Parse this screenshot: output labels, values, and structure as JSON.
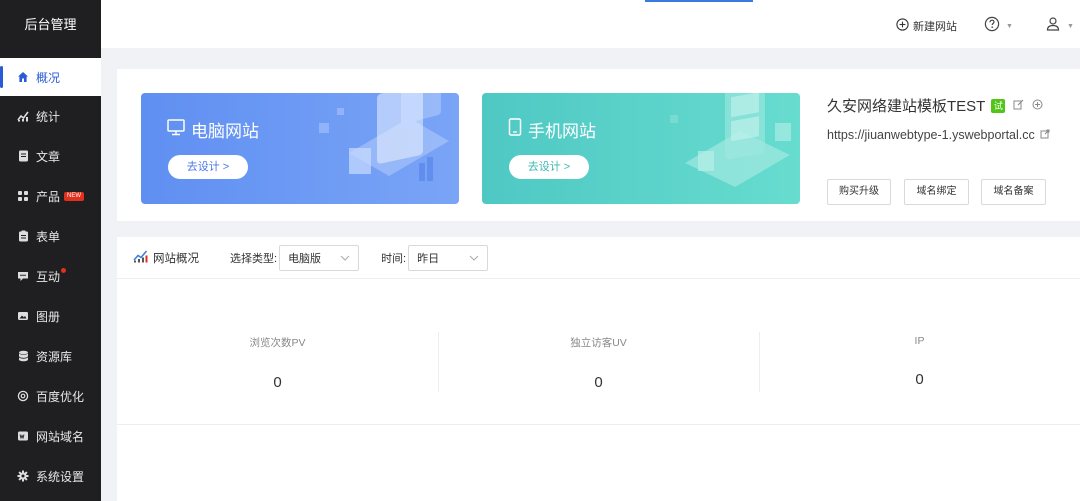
{
  "sidebar": {
    "title": "后台管理",
    "items": [
      {
        "label": "概况",
        "icon": "home-icon",
        "active": true
      },
      {
        "label": "统计",
        "icon": "chart-icon"
      },
      {
        "label": "文章",
        "icon": "document-icon"
      },
      {
        "label": "产品",
        "icon": "grid-icon",
        "badge": "NEW"
      },
      {
        "label": "表单",
        "icon": "form-icon"
      },
      {
        "label": "互动",
        "icon": "chat-icon"
      },
      {
        "label": "图册",
        "icon": "album-icon"
      },
      {
        "label": "资源库",
        "icon": "database-icon"
      },
      {
        "label": "百度优化",
        "icon": "seo-icon"
      },
      {
        "label": "网站域名",
        "icon": "domain-icon"
      },
      {
        "label": "系统设置",
        "icon": "gear-icon"
      }
    ]
  },
  "header": {
    "new_site_label": "新建网站"
  },
  "cards": {
    "pc": {
      "title": "电脑网站",
      "button": "去设计 >"
    },
    "mobile": {
      "title": "手机网站",
      "button": "去设计 >"
    }
  },
  "site": {
    "name": "久安网络建站模板TEST",
    "trial_badge": "试",
    "url": "https://jiuanwebtype-1.yswebportal.cc",
    "actions": [
      "购买升级",
      "域名绑定",
      "域名备案"
    ]
  },
  "overview": {
    "title": "网站概况",
    "type_label": "选择类型:",
    "type_value": "电脑版",
    "time_label": "时间:",
    "time_value": "昨日",
    "stats": [
      {
        "label": "浏览次数PV",
        "value": "0"
      },
      {
        "label": "独立访客UV",
        "value": "0"
      },
      {
        "label": "IP",
        "value": "0"
      }
    ]
  },
  "colors": {
    "accent": "#2a5bd7",
    "sidebar_bg": "#1f1f21",
    "pc_card": "#6b98f4",
    "mobile_card": "#5cd2c9",
    "trial_badge": "#52c41a"
  }
}
